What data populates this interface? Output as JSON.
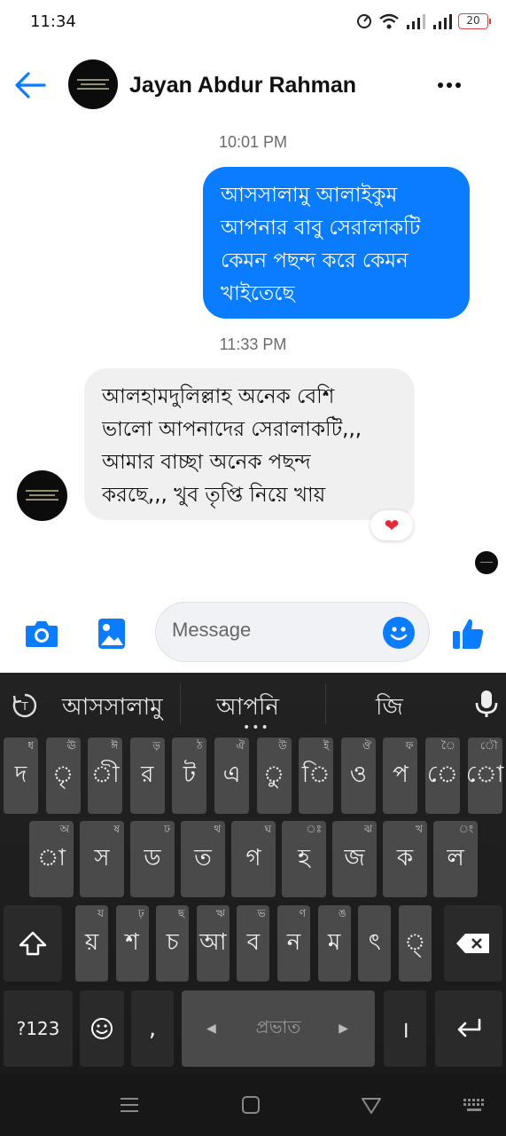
{
  "status_bar": {
    "time": "11:34",
    "battery": "20"
  },
  "header": {
    "contact_name": "Jayan Abdur Rahman"
  },
  "messages": [
    {
      "timestamp": "10:01 PM",
      "direction": "outgoing",
      "lines": [
        "আসসালামু আলাইকুম",
        "আপনার বাবু সেরালাকটি",
        "কেমন পছন্দ করে কেমন",
        "খাইতেছে"
      ]
    },
    {
      "timestamp": "11:33 PM",
      "direction": "incoming",
      "lines": [
        "আলহামদুলিল্লাহ অনেক বেশি",
        "ভালো আপনাদের সেরালাকটি,,,",
        "আমার বাচ্ছা অনেক পছন্দ",
        "করছে,,, খুব তৃপ্তি নিয়ে খায়"
      ],
      "reaction": "❤"
    }
  ],
  "composer": {
    "placeholder": "Message"
  },
  "keyboard": {
    "suggestions": [
      "আসসালামু",
      "আপনি",
      "জি"
    ],
    "row1": [
      {
        "main": "দ",
        "hint": "ধ"
      },
      {
        "main": "ৃ",
        "hint": "ঊ"
      },
      {
        "main": "ী",
        "hint": "ঈ"
      },
      {
        "main": "র",
        "hint": "ড়"
      },
      {
        "main": "ট",
        "hint": "ঠ"
      },
      {
        "main": "এ",
        "hint": "ঐ"
      },
      {
        "main": "ু",
        "hint": "উ"
      },
      {
        "main": "ি",
        "hint": "ই"
      },
      {
        "main": "ও",
        "hint": "ঔ"
      },
      {
        "main": "প",
        "hint": "ফ"
      },
      {
        "main": "ে",
        "hint": "ৈ"
      },
      {
        "main": "ো",
        "hint": "ৌ"
      }
    ],
    "row2": [
      {
        "main": "া",
        "hint": "অ"
      },
      {
        "main": "স",
        "hint": "ষ"
      },
      {
        "main": "ড",
        "hint": "ঢ"
      },
      {
        "main": "ত",
        "hint": "থ"
      },
      {
        "main": "গ",
        "hint": "ঘ"
      },
      {
        "main": "হ",
        "hint": "ঃ"
      },
      {
        "main": "জ",
        "hint": "ঝ"
      },
      {
        "main": "ক",
        "hint": "খ"
      },
      {
        "main": "ল",
        "hint": "ং"
      }
    ],
    "row3": [
      {
        "main": "য়",
        "hint": "য"
      },
      {
        "main": "শ",
        "hint": "ঢ়"
      },
      {
        "main": "চ",
        "hint": "ছ"
      },
      {
        "main": "আ",
        "hint": "ঋ"
      },
      {
        "main": "ব",
        "hint": "ভ"
      },
      {
        "main": "ন",
        "hint": "ণ"
      },
      {
        "main": "ম",
        "hint": "ঙ"
      },
      {
        "main": "ৎ",
        "hint": ""
      },
      {
        "main": "্",
        "hint": ""
      }
    ],
    "numbers_key": "?123",
    "comma_key": ",",
    "space_label": "প্রভাত",
    "period_key": "।"
  }
}
